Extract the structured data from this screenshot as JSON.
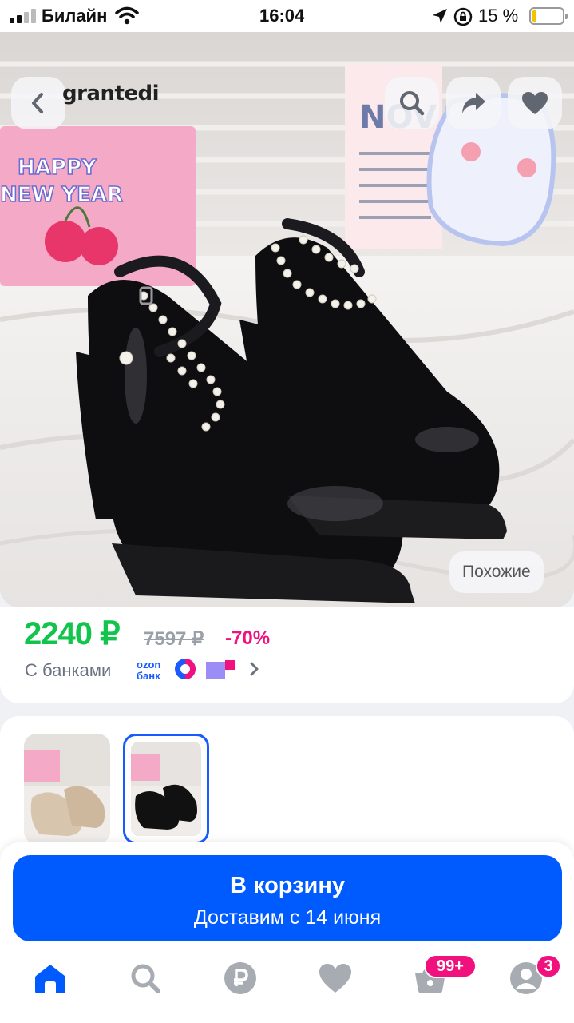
{
  "status_bar": {
    "carrier": "Билайн",
    "time": "16:04",
    "battery_percent": "15 %",
    "battery_level": 0.15
  },
  "product_image": {
    "watermark": "grantedi",
    "similar_button_label": "Похожие",
    "actions": [
      "back-icon",
      "search-icon",
      "share-icon",
      "heart-icon"
    ]
  },
  "price": {
    "current": "2240 ₽",
    "old": "7597 ₽",
    "discount": "-70%",
    "banks_label": "С банками",
    "ozon_bank_line1": "ozon",
    "ozon_bank_line2": "банк"
  },
  "variants": {
    "selected_index": 1,
    "items": [
      "beige-shoes",
      "black-shoes"
    ]
  },
  "cart": {
    "button_label": "В корзину",
    "delivery_text": "Доставим с 14 июня"
  },
  "tabbar": {
    "items": [
      "home-icon",
      "search-icon",
      "ruble-icon",
      "heart-icon",
      "basket-icon",
      "profile-icon"
    ],
    "active": "home-icon",
    "cart_badge": "99+",
    "profile_badge": "3"
  },
  "colors": {
    "accent_blue": "#005bff",
    "price_green": "#10c44c",
    "discount_pink": "#f1117e",
    "icon_gray": "#a7acb3"
  }
}
